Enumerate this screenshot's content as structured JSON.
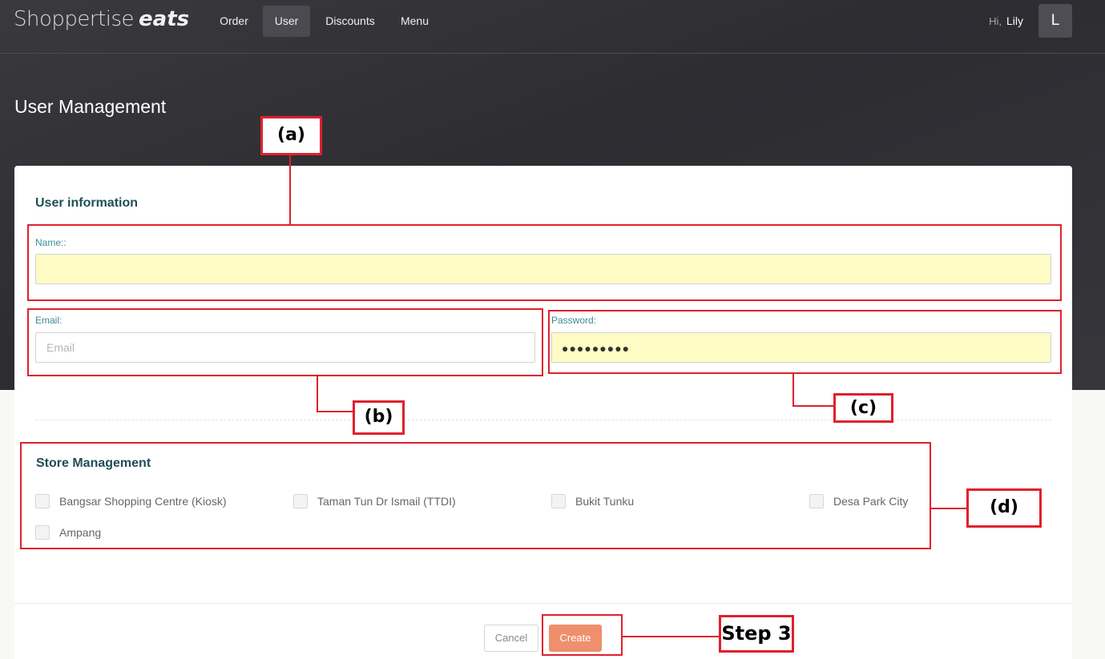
{
  "header": {
    "logo_light": "Shoppertise",
    "logo_bold": "eats",
    "nav": [
      {
        "label": "Order"
      },
      {
        "label": "User",
        "active": true
      },
      {
        "label": "Discounts"
      },
      {
        "label": "Menu"
      }
    ],
    "greeting": "Hi,",
    "user_name": "Lily",
    "avatar_initial": "L"
  },
  "page": {
    "title": "User Management"
  },
  "user_info": {
    "section_title": "User information",
    "name_label": "Name::",
    "name_value": "",
    "email_label": "Email:",
    "email_placeholder": "Email",
    "password_label": "Password:",
    "password_mask": "●●●●●●●●●"
  },
  "store_management": {
    "section_title": "Store Management",
    "stores": [
      {
        "label": "Bangsar Shopping Centre (Kiosk)",
        "checked": false
      },
      {
        "label": "Taman Tun Dr Ismail (TTDI)",
        "checked": false
      },
      {
        "label": "Bukit Tunku",
        "checked": false
      },
      {
        "label": "Desa Park City",
        "checked": false
      },
      {
        "label": "Ampang",
        "checked": false
      }
    ]
  },
  "actions": {
    "cancel_label": "Cancel",
    "create_label": "Create"
  },
  "annotations": {
    "a": "(a)",
    "b": "(b)",
    "c": "(c)",
    "d": "(d)",
    "step": "Step 3"
  },
  "colors": {
    "accent_create": "#ef8f6b",
    "annotation_red": "#e0202e",
    "section_title": "#1f4e57",
    "label_teal": "#3a8b95",
    "autofill_yellow": "#fefbc5"
  }
}
